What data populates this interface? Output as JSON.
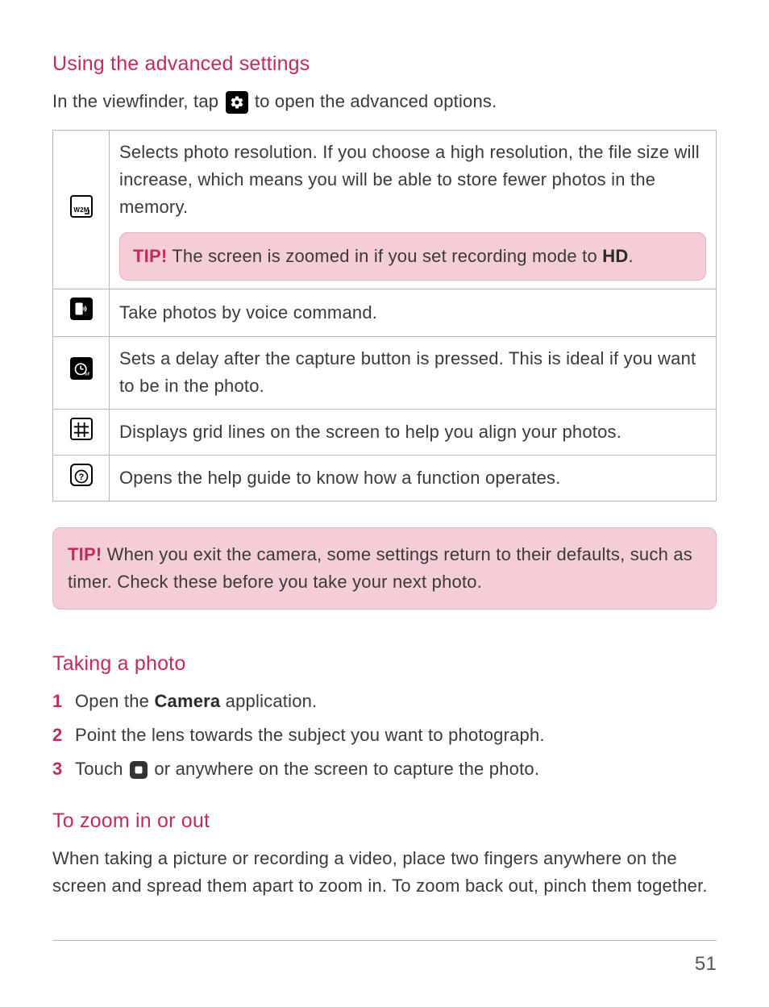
{
  "section1": {
    "heading": "Using the advanced settings",
    "intro_before": "In the viewfinder, tap ",
    "intro_after": " to open the advanced options."
  },
  "table": {
    "row0": {
      "desc": "Selects photo resolution. If you choose a high resolution, the file size will increase, which means you will be able to store fewer photos in the memory.",
      "tip_label": "TIP!",
      "tip_before": " The screen is zoomed in if you set recording mode to ",
      "tip_bold": "HD",
      "tip_after": "."
    },
    "row1": {
      "desc": "Take photos by voice command."
    },
    "row2": {
      "desc": "Sets a delay after the capture button is pressed. This is ideal if you want to be in the photo."
    },
    "row3": {
      "desc": "Displays grid lines on the screen to help you align your photos."
    },
    "row4": {
      "desc": "Opens the help guide to know how a function operates."
    }
  },
  "tip_outer": {
    "label": "TIP!",
    "text": " When you exit the camera, some settings return to their defaults, such as timer. Check these before you take your next photo."
  },
  "section2": {
    "heading": "Taking a photo",
    "step1_before": "Open the ",
    "step1_bold": "Camera",
    "step1_after": " application.",
    "step2": "Point the lens towards the subject you want to photograph.",
    "step3_before": "Touch ",
    "step3_after": " or anywhere on the screen to capture the photo."
  },
  "section3": {
    "heading": "To zoom in or out",
    "text": "When taking a picture or recording a video, place two fingers anywhere on the screen and spread them apart to zoom in. To zoom back out, pinch them together."
  },
  "page_number": "51"
}
